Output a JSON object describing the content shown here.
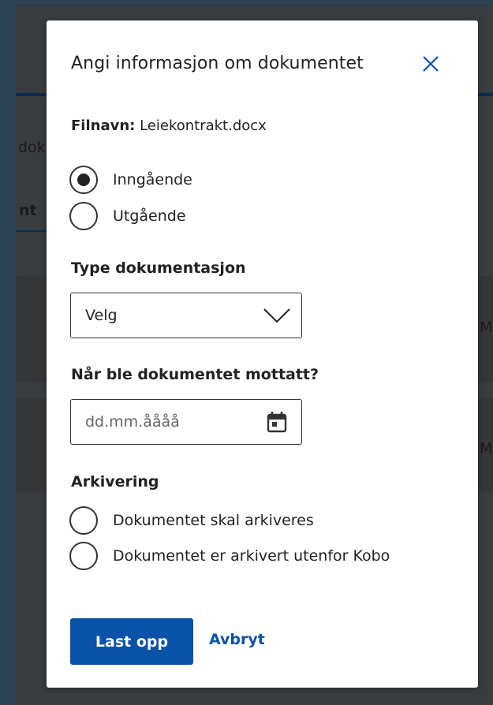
{
  "background": {
    "fragments": [
      "dok",
      "nt",
      "M",
      "M"
    ]
  },
  "modal": {
    "title": "Angi informasjon om dokumentet",
    "close_icon": "close-icon",
    "filename_label": "Filnavn:",
    "filename_value": "Leiekontrakt.docx",
    "direction": {
      "options": [
        {
          "label": "Inngående",
          "selected": true
        },
        {
          "label": "Utgående",
          "selected": false
        }
      ]
    },
    "doc_type": {
      "label": "Type dokumentasjon",
      "selected": "Velg",
      "icon": "chevron-down-icon"
    },
    "received_date": {
      "label": "Når ble dokumentet mottatt?",
      "placeholder": "dd.mm.åååå",
      "icon": "calendar-icon"
    },
    "archiving": {
      "label": "Arkivering",
      "options": [
        {
          "label": "Dokumentet skal arkiveres",
          "selected": false
        },
        {
          "label": "Dokumentet er arkivert utenfor Kobo",
          "selected": false
        }
      ]
    },
    "buttons": {
      "submit": "Last opp",
      "cancel": "Avbryt"
    }
  },
  "colors": {
    "primary": "#0a52a8",
    "overlay": "#3a3d40"
  }
}
